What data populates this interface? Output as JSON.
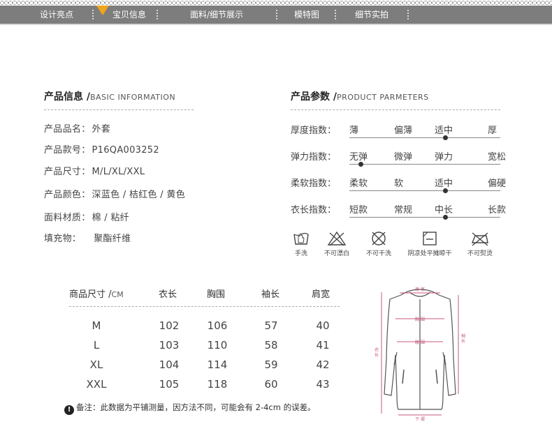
{
  "nav": {
    "tabs": [
      {
        "label": "设计亮点"
      },
      {
        "label": "宝贝信息"
      },
      {
        "label": "面料/细节展示"
      },
      {
        "label": "模特图"
      },
      {
        "label": "细节实拍"
      }
    ],
    "active_index": 1
  },
  "basic_info": {
    "title_cn": "产品信息 /",
    "title_en": "BASIC INFORMATION",
    "rows": [
      {
        "label": "产品品名：",
        "value": "外套"
      },
      {
        "label": "产品款号：",
        "value": "P16QA003252"
      },
      {
        "label": "产品尺寸：",
        "value": "M/L/XL/XXL"
      },
      {
        "label": "产品颜色：",
        "value": "深蓝色 / 桔红色 / 黄色"
      },
      {
        "label": "面料材质：",
        "value": "棉 / 粘纤"
      },
      {
        "label": "填充物：",
        "value": "聚酯纤维"
      }
    ]
  },
  "parameters": {
    "title_cn": "产品参数 /",
    "title_en": "PRODUCT PARMETERS",
    "rows": [
      {
        "label": "厚度指数：",
        "options": [
          "薄",
          "偏薄",
          "适中",
          "厚"
        ],
        "selected": 2
      },
      {
        "label": "弹力指数：",
        "options": [
          "无弹",
          "微弹",
          "弹力",
          "宽松"
        ],
        "selected": 0
      },
      {
        "label": "柔软指数：",
        "options": [
          "柔软",
          "软",
          "适中",
          "偏硬"
        ],
        "selected": 2
      },
      {
        "label": "衣长指数：",
        "options": [
          "短款",
          "常规",
          "中长",
          "长款"
        ],
        "selected": 2
      }
    ]
  },
  "care": [
    {
      "icon": "hand-wash-icon",
      "label": "手洗"
    },
    {
      "icon": "no-bleach-icon",
      "label": "不可漂白"
    },
    {
      "icon": "no-dry-clean-icon",
      "label": "不可干洗"
    },
    {
      "icon": "shade-dry-flat-icon",
      "label": "阴凉处平摊晾干"
    },
    {
      "icon": "no-iron-icon",
      "label": "不可熨烫"
    }
  ],
  "size_table": {
    "header_cn": "商品尺寸 /",
    "header_unit": "CM",
    "columns": [
      "衣长",
      "胸围",
      "袖长",
      "肩宽"
    ],
    "rows": [
      {
        "size": "M",
        "values": [
          "102",
          "106",
          "57",
          "40"
        ]
      },
      {
        "size": "L",
        "values": [
          "103",
          "110",
          "58",
          "41"
        ]
      },
      {
        "size": "XL",
        "values": [
          "104",
          "114",
          "59",
          "42"
        ]
      },
      {
        "size": "XXL",
        "values": [
          "105",
          "118",
          "60",
          "43"
        ]
      }
    ]
  },
  "note": {
    "text": "备注：此数据为平铺测量，因方法不同，可能会有 2-4cm 的误差。"
  },
  "diagram": {
    "labels": {
      "shoulder": "肩 宽",
      "chest": "胸 围",
      "waist": "腰 围",
      "length": "衣 长",
      "sleeve": "袖 长",
      "hem": "下 摆"
    },
    "measure_color": "#c8577d"
  },
  "colors": {
    "nav_bg": "#7d7d7d",
    "nav_active": "#f0a31c"
  }
}
